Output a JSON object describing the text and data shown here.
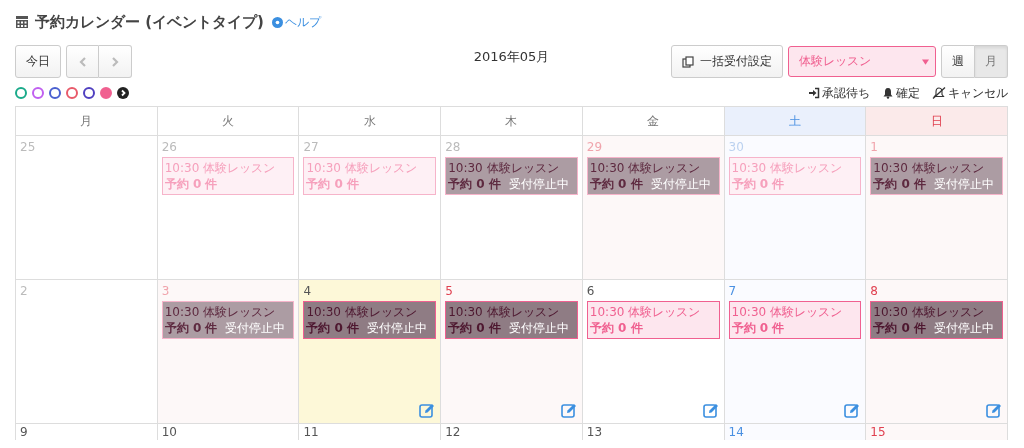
{
  "title": "予約カレンダー (イベントタイプ)",
  "help": "ヘルプ",
  "toolbar": {
    "today": "今日",
    "month_label": "2016年05月",
    "bulk_button": "一括受付設定",
    "event_select": "体験レッスン",
    "views": [
      {
        "label": "週",
        "selected": false
      },
      {
        "label": "月",
        "selected": true
      }
    ]
  },
  "legend_colors": [
    {
      "color": "#1aaa8a",
      "selected": false
    },
    {
      "color": "#c060f0",
      "selected": false
    },
    {
      "color": "#4a60d0",
      "selected": false
    },
    {
      "color": "#e85a6a",
      "selected": false
    },
    {
      "color": "#5040c0",
      "selected": false
    },
    {
      "color": "#f06090",
      "selected": true
    }
  ],
  "status_legend": [
    {
      "kind": "pending",
      "label": "承認待ち"
    },
    {
      "kind": "confirmed",
      "label": "確定"
    },
    {
      "kind": "cancelled",
      "label": "キャンセル"
    }
  ],
  "weekdays": [
    {
      "label": "月",
      "kind": "weekday"
    },
    {
      "label": "火",
      "kind": "weekday"
    },
    {
      "label": "水",
      "kind": "weekday"
    },
    {
      "label": "木",
      "kind": "weekday"
    },
    {
      "label": "金",
      "kind": "weekday"
    },
    {
      "label": "土",
      "kind": "saturday"
    },
    {
      "label": "日",
      "kind": "sunday"
    }
  ],
  "weeks": [
    [
      {
        "day": "25",
        "kind": "weekday",
        "past": true,
        "today": false,
        "editable": false
      },
      {
        "day": "26",
        "kind": "weekday",
        "past": true,
        "today": false,
        "editable": false,
        "event": {
          "title": "10:30 体験レッスン",
          "count": "予約 0 件",
          "stopped": false
        }
      },
      {
        "day": "27",
        "kind": "weekday",
        "past": true,
        "today": false,
        "editable": false,
        "event": {
          "title": "10:30 体験レッスン",
          "count": "予約 0 件",
          "stopped": false
        }
      },
      {
        "day": "28",
        "kind": "weekday",
        "past": true,
        "today": false,
        "editable": false,
        "event": {
          "title": "10:30 体験レッスン",
          "count": "予約 0 件",
          "stopped": true,
          "stop_label": "受付停止中"
        }
      },
      {
        "day": "29",
        "kind": "holiday",
        "past": true,
        "today": false,
        "editable": false,
        "event": {
          "title": "10:30 体験レッスン",
          "count": "予約 0 件",
          "stopped": true,
          "stop_label": "受付停止中"
        }
      },
      {
        "day": "30",
        "kind": "saturday",
        "past": true,
        "today": false,
        "editable": false,
        "event": {
          "title": "10:30 体験レッスン",
          "count": "予約 0 件",
          "stopped": false
        }
      },
      {
        "day": "1",
        "kind": "sunday",
        "past": true,
        "today": false,
        "editable": false,
        "event": {
          "title": "10:30 体験レッスン",
          "count": "予約 0 件",
          "stopped": true,
          "stop_label": "受付停止中"
        }
      }
    ],
    [
      {
        "day": "2",
        "kind": "weekday",
        "past": true,
        "today": false,
        "editable": false
      },
      {
        "day": "3",
        "kind": "holiday",
        "past": true,
        "today": false,
        "editable": false,
        "event": {
          "title": "10:30 体験レッスン",
          "count": "予約 0 件",
          "stopped": true,
          "stop_label": "受付停止中"
        }
      },
      {
        "day": "4",
        "kind": "holiday",
        "past": false,
        "today": true,
        "editable": true,
        "event": {
          "title": "10:30 体験レッスン",
          "count": "予約 0 件",
          "stopped": true,
          "stop_label": "受付停止中"
        }
      },
      {
        "day": "5",
        "kind": "holiday",
        "past": false,
        "today": false,
        "editable": true,
        "event": {
          "title": "10:30 体験レッスン",
          "count": "予約 0 件",
          "stopped": true,
          "stop_label": "受付停止中"
        }
      },
      {
        "day": "6",
        "kind": "weekday",
        "past": false,
        "today": false,
        "editable": true,
        "event": {
          "title": "10:30 体験レッスン",
          "count": "予約 0 件",
          "stopped": false
        }
      },
      {
        "day": "7",
        "kind": "saturday",
        "past": false,
        "today": false,
        "editable": true,
        "event": {
          "title": "10:30 体験レッスン",
          "count": "予約 0 件",
          "stopped": false
        }
      },
      {
        "day": "8",
        "kind": "sunday",
        "past": false,
        "today": false,
        "editable": true,
        "event": {
          "title": "10:30 体験レッスン",
          "count": "予約 0 件",
          "stopped": true,
          "stop_label": "受付停止中"
        }
      }
    ],
    [
      {
        "day": "9",
        "kind": "weekday",
        "past": false,
        "today": false,
        "editable": false
      },
      {
        "day": "10",
        "kind": "weekday",
        "past": false,
        "today": false,
        "editable": false
      },
      {
        "day": "11",
        "kind": "weekday",
        "past": false,
        "today": false,
        "editable": false
      },
      {
        "day": "12",
        "kind": "weekday",
        "past": false,
        "today": false,
        "editable": false
      },
      {
        "day": "13",
        "kind": "weekday",
        "past": false,
        "today": false,
        "editable": false
      },
      {
        "day": "14",
        "kind": "saturday",
        "past": false,
        "today": false,
        "editable": false
      },
      {
        "day": "15",
        "kind": "sunday",
        "past": false,
        "today": false,
        "editable": false
      }
    ]
  ]
}
